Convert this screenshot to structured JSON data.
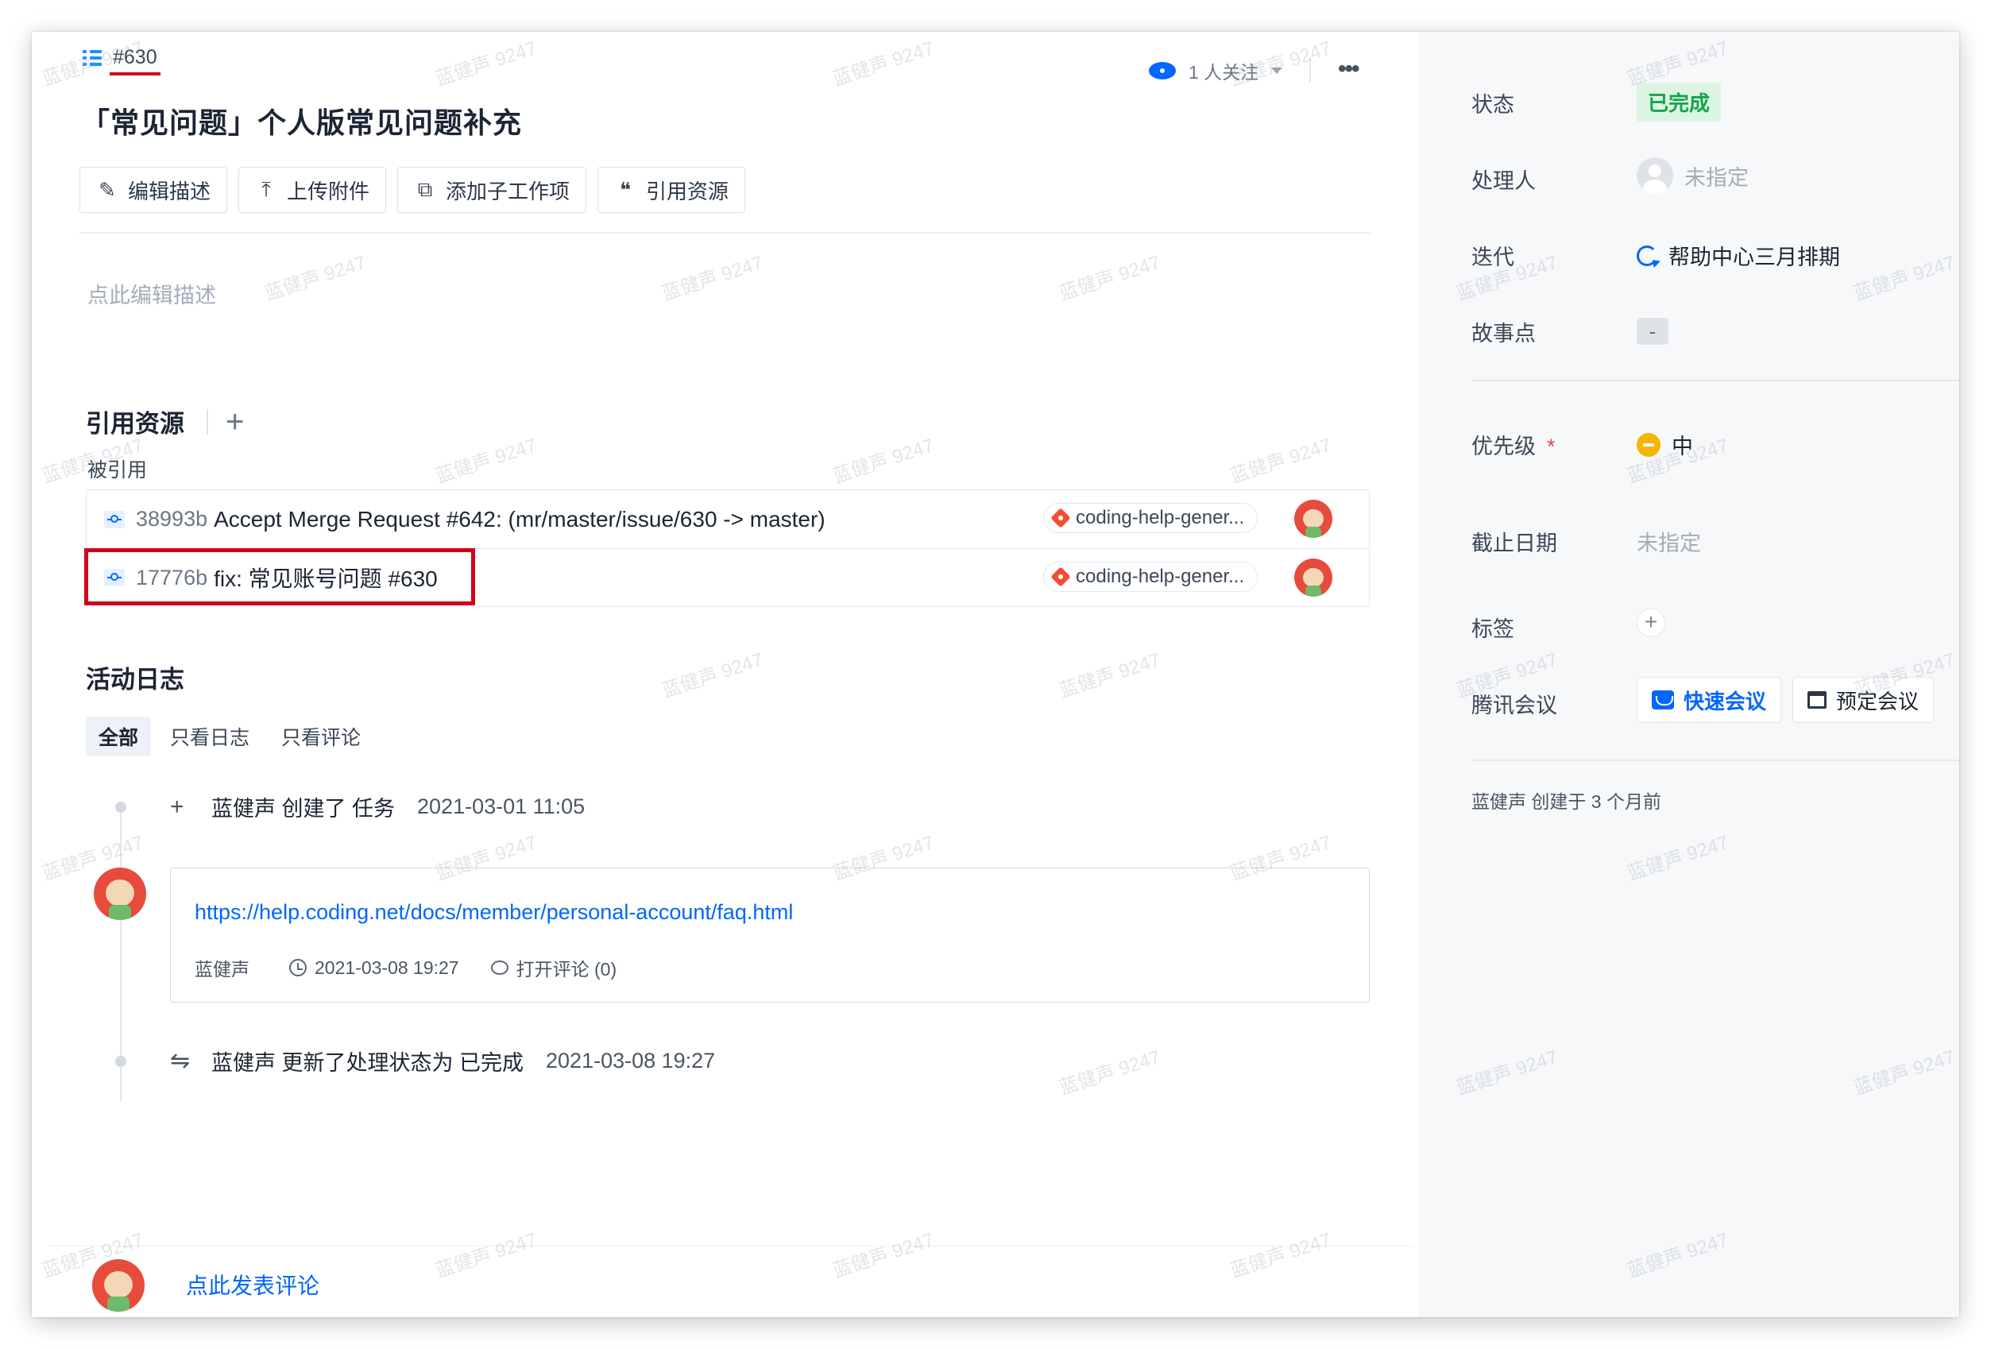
{
  "issue": {
    "number": "#630",
    "title": "「常见问题」个人版常见问题补充",
    "watch_label": "1 人关注",
    "more_label": "•••"
  },
  "toolbar": {
    "edit_desc": "编辑描述",
    "upload": "上传附件",
    "add_sub": "添加子工作项",
    "cite": "引用资源"
  },
  "description": {
    "placeholder": "点此编辑描述"
  },
  "references": {
    "title": "引用资源",
    "add": "+",
    "cited_label": "被引用",
    "rows": [
      {
        "hash": "38993b",
        "message": "Accept Merge Request #642: (mr/master/issue/630 -> master)",
        "repo": "coding-help-gener..."
      },
      {
        "hash": "17776b",
        "message": "fix: 常见账号问题 #630",
        "repo": "coding-help-gener..."
      }
    ]
  },
  "activity": {
    "title": "活动日志",
    "tabs": [
      "全部",
      "只看日志",
      "只看评论"
    ],
    "created_log": {
      "icon": "+",
      "text": "蓝健声 创建了 任务",
      "time": "2021-03-01 11:05"
    },
    "comment": {
      "link": "https://help.coding.net/docs/member/personal-account/faq.html",
      "author": "蓝健声",
      "time": "2021-03-08 19:27",
      "reply": "打开评论 (0)"
    },
    "status_log": {
      "icon": "⇋",
      "text": "蓝健声 更新了处理状态为  已完成",
      "time": "2021-03-08 19:27"
    }
  },
  "comment_bar": {
    "cta": "点此发表评论"
  },
  "sidebar": {
    "status": {
      "label": "状态",
      "value": "已完成"
    },
    "assignee": {
      "label": "处理人",
      "value": "未指定"
    },
    "iteration": {
      "label": "迭代",
      "value": "帮助中心三月排期"
    },
    "story_points": {
      "label": "故事点",
      "value": "-"
    },
    "priority": {
      "label": "优先级",
      "required": "*",
      "value": "中"
    },
    "due_date": {
      "label": "截止日期",
      "value": "未指定"
    },
    "tags": {
      "label": "标签",
      "add": "+"
    },
    "meeting": {
      "label": "腾讯会议",
      "quick": "快速会议",
      "schedule": "预定会议"
    },
    "created": "蓝健声  创建于 3 个月前"
  },
  "watermark": "蓝健声 9247",
  "colors": {
    "accent": "#0066ff",
    "done": "#16a34a",
    "highlight": "#d0021b",
    "priority": "#f6b500"
  }
}
